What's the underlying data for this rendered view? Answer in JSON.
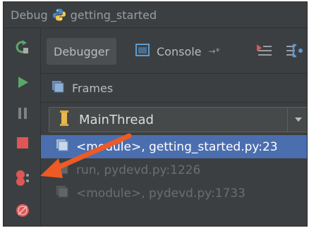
{
  "title": {
    "prefix": "Debug",
    "config_name": "getting_started"
  },
  "tabs": [
    {
      "label": "Debugger",
      "active": true
    },
    {
      "label": "Console",
      "suffix": "→*"
    }
  ],
  "frames_panel": {
    "title": "Frames",
    "thread": "MainThread"
  },
  "frames": [
    {
      "text": "<module>, getting_started.py:23",
      "selected": true
    },
    {
      "text": "run, pydevd.py:1226",
      "selected": false
    },
    {
      "text": "<module>, pydevd.py:1733",
      "selected": false
    }
  ],
  "sidebar_icons": [
    "rerun-icon",
    "resume-icon",
    "pause-icon",
    "stop-icon",
    "view-breakpoints-icon",
    "mute-breakpoints-icon"
  ],
  "colors": {
    "panel_bg": "#3c3f41",
    "selection": "#4b6eaf",
    "annotation_arrow": "#ee5a24",
    "resume_green": "#59a869",
    "stop_red": "#e05555"
  }
}
